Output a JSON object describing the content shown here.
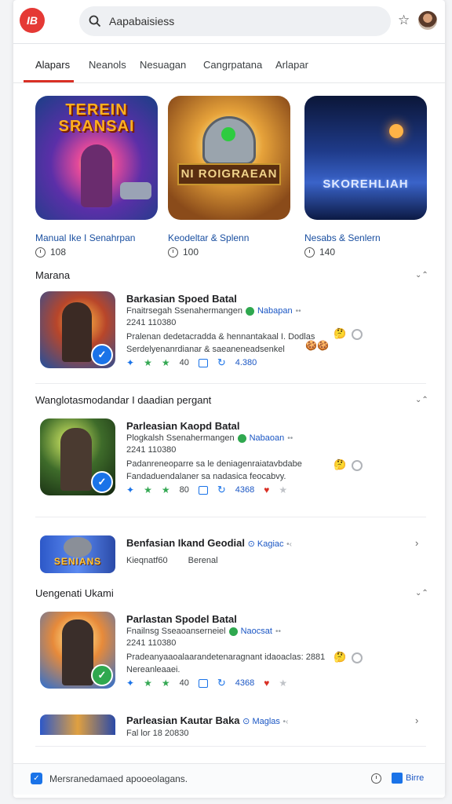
{
  "header": {
    "logo_text": "IB",
    "search_value": "Aapabaisiess"
  },
  "tabs": [
    "Alapars",
    "Neanols",
    "Nesuagan",
    "Cangrpatana",
    "Arlapar"
  ],
  "featured": [
    {
      "art": "TEREIN SRANSAI",
      "title": "Manual Ike I Senahrpan",
      "meta": "108"
    },
    {
      "art": "NI ROIGRAEAN",
      "title": "Keodeltar & Splenn",
      "meta": "100"
    },
    {
      "art": "SKOREHLIAH",
      "title": "Nesabs & Senlern",
      "meta": "140"
    }
  ],
  "sections": {
    "s1": "Marana",
    "s2": "Wanglotasmodandar I daadian pergant",
    "s3": "Uengenati Ukami"
  },
  "items": [
    {
      "title": "Barkasian Spoed Batal",
      "sub": "Fnaitrsegah Ssenahermangen",
      "tag": "Nabapan",
      "date": "2241 110380",
      "desc": "Pralenan dedetacradda & hennantakaal I. Dodlas Serdelyenanrdianar & saeaneneadsenkel",
      "rating": "40",
      "count": "4.380"
    },
    {
      "title": "Parleasian Kaopd Batal",
      "sub": "Plogkalsh Ssenahermangen",
      "tag": "Nabaoan",
      "date": "2241 110380",
      "desc": "Padanreneoparre sa le deniagenraiatavbdabe Fandaduendalaner sa nadasica feocabvy.",
      "rating": "80",
      "count": "4368"
    },
    {
      "title": "Parlastan Spodel Batal",
      "sub": "Fnailnsg Sseaoanserneiel",
      "tag": "Naocsat",
      "date": "2241 110380",
      "desc": "Pradeanyaaoalaarandetenaragnant idaoaclas: 2881 Nereanleaaei.",
      "rating": "40",
      "count": "4368"
    }
  ],
  "banners": [
    {
      "art": "SENIANS",
      "title": "Benfasian Ikand Geodial",
      "tag": "Kagiac",
      "sub1": "Kieqnatf60",
      "sub2": "Berenal"
    },
    {
      "title": "Parleasian Kautar Baka",
      "tag": "Maglas",
      "sub1": "Fal lor 18 20830"
    }
  ],
  "bottom": {
    "text": "Mersranedamaed apooeolagans.",
    "open_label": "Birre"
  }
}
